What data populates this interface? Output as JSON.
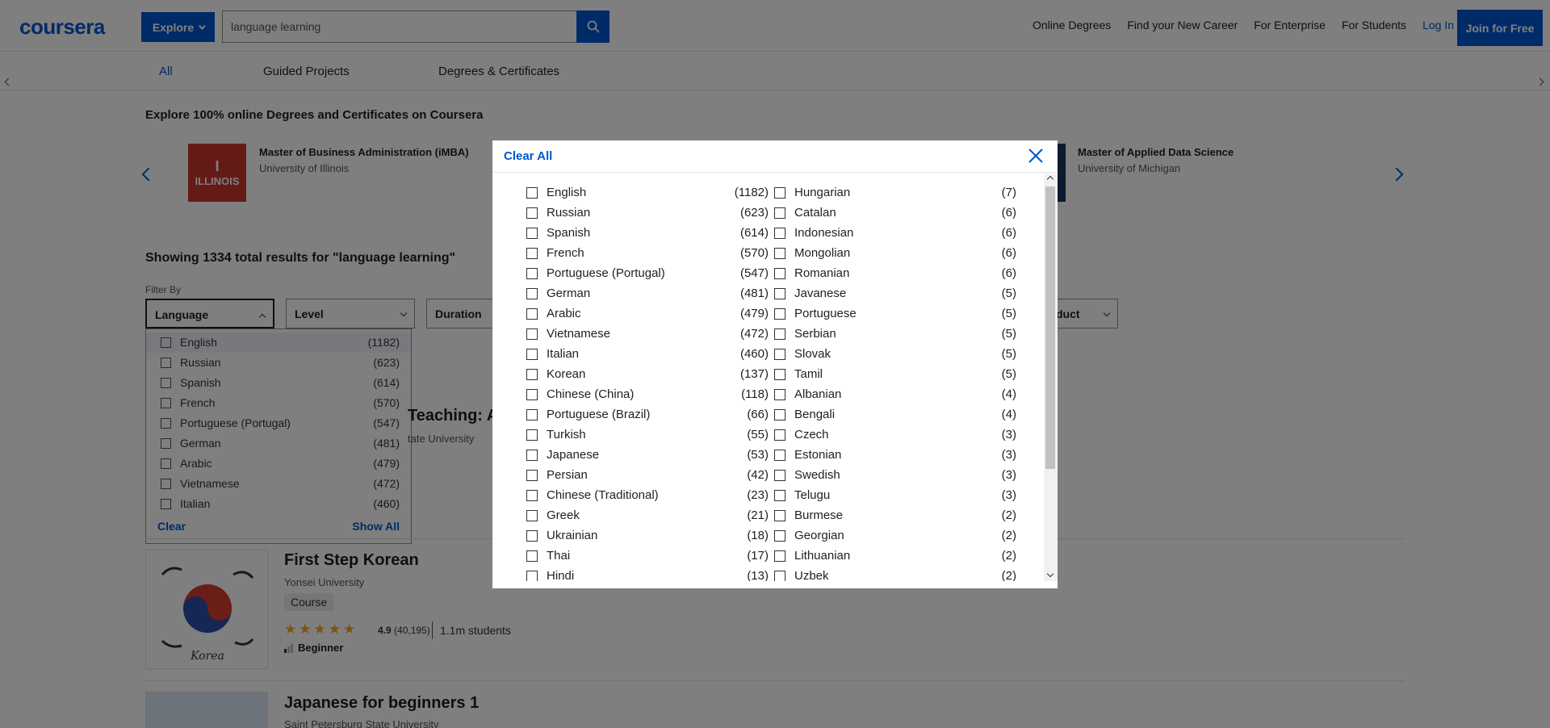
{
  "header": {
    "logo": "coursera",
    "explore_label": "Explore",
    "search_value": "language learning",
    "nav": [
      "Online Degrees",
      "Find your New Career",
      "For Enterprise",
      "For Students"
    ],
    "login_label": "Log In",
    "join_label": "Join for Free"
  },
  "tabs": [
    "All",
    "Guided Projects",
    "Degrees & Certificates"
  ],
  "explore": {
    "heading": "Explore 100% online Degrees and Certificates on Coursera",
    "degrees": [
      {
        "logo_text": "ILLINOIS",
        "title": "Master of Business Administration (iMBA)",
        "university": "University of Illinois"
      },
      {
        "title": "Master of Applied Data Science",
        "university": "University of Michigan"
      }
    ]
  },
  "results": {
    "count_text": "Showing 1334 total results for \"language learning\"",
    "filter_by": "Filter By",
    "filters": [
      "Language",
      "Level",
      "Duration",
      "duct"
    ]
  },
  "dropdown": {
    "items": [
      {
        "label": "English",
        "count": "(1182)"
      },
      {
        "label": "Russian",
        "count": "(623)"
      },
      {
        "label": "Spanish",
        "count": "(614)"
      },
      {
        "label": "French",
        "count": "(570)"
      },
      {
        "label": "Portuguese (Portugal)",
        "count": "(547)"
      },
      {
        "label": "German",
        "count": "(481)"
      },
      {
        "label": "Arabic",
        "count": "(479)"
      },
      {
        "label": "Vietnamese",
        "count": "(472)"
      },
      {
        "label": "Italian",
        "count": "(460)"
      }
    ],
    "clear_label": "Clear",
    "show_all_label": "Show All"
  },
  "courses": {
    "peek_title": "Teaching: An",
    "peek_sub": "tate University",
    "list": [
      {
        "title": "First Step Korean",
        "university": "Yonsei University",
        "badge": "Course",
        "rating": "4.9",
        "reviews": "(40,195)",
        "students": "1.1m students",
        "level": "Beginner",
        "img_caption": "Korea"
      },
      {
        "title": "Japanese for beginners 1",
        "university": "Saint Petersburg State University"
      }
    ]
  },
  "modal": {
    "clear_all": "Clear All",
    "left_column": [
      {
        "label": "English",
        "count": "(1182)"
      },
      {
        "label": "Russian",
        "count": "(623)"
      },
      {
        "label": "Spanish",
        "count": "(614)"
      },
      {
        "label": "French",
        "count": "(570)"
      },
      {
        "label": "Portuguese (Portugal)",
        "count": "(547)"
      },
      {
        "label": "German",
        "count": "(481)"
      },
      {
        "label": "Arabic",
        "count": "(479)"
      },
      {
        "label": "Vietnamese",
        "count": "(472)"
      },
      {
        "label": "Italian",
        "count": "(460)"
      },
      {
        "label": "Korean",
        "count": "(137)"
      },
      {
        "label": "Chinese (China)",
        "count": "(118)"
      },
      {
        "label": "Portuguese (Brazil)",
        "count": "(66)"
      },
      {
        "label": "Turkish",
        "count": "(55)"
      },
      {
        "label": "Japanese",
        "count": "(53)"
      },
      {
        "label": "Persian",
        "count": "(42)"
      },
      {
        "label": "Chinese (Traditional)",
        "count": "(23)"
      },
      {
        "label": "Greek",
        "count": "(21)"
      },
      {
        "label": "Ukrainian",
        "count": "(18)"
      },
      {
        "label": "Thai",
        "count": "(17)"
      },
      {
        "label": "Hindi",
        "count": "(13)"
      }
    ],
    "right_column": [
      {
        "label": "Hungarian",
        "count": "(7)"
      },
      {
        "label": "Catalan",
        "count": "(6)"
      },
      {
        "label": "Indonesian",
        "count": "(6)"
      },
      {
        "label": "Mongolian",
        "count": "(6)"
      },
      {
        "label": "Romanian",
        "count": "(6)"
      },
      {
        "label": "Javanese",
        "count": "(5)"
      },
      {
        "label": "Portuguese",
        "count": "(5)"
      },
      {
        "label": "Serbian",
        "count": "(5)"
      },
      {
        "label": "Slovak",
        "count": "(5)"
      },
      {
        "label": "Tamil",
        "count": "(5)"
      },
      {
        "label": "Albanian",
        "count": "(4)"
      },
      {
        "label": "Bengali",
        "count": "(4)"
      },
      {
        "label": "Czech",
        "count": "(3)"
      },
      {
        "label": "Estonian",
        "count": "(3)"
      },
      {
        "label": "Swedish",
        "count": "(3)"
      },
      {
        "label": "Telugu",
        "count": "(3)"
      },
      {
        "label": "Burmese",
        "count": "(2)"
      },
      {
        "label": "Georgian",
        "count": "(2)"
      },
      {
        "label": "Lithuanian",
        "count": "(2)"
      },
      {
        "label": "Uzbek",
        "count": "(2)"
      }
    ]
  },
  "colors": {
    "brand": "#0056d2",
    "star": "#f5a623",
    "illinois": "#c8372d"
  }
}
